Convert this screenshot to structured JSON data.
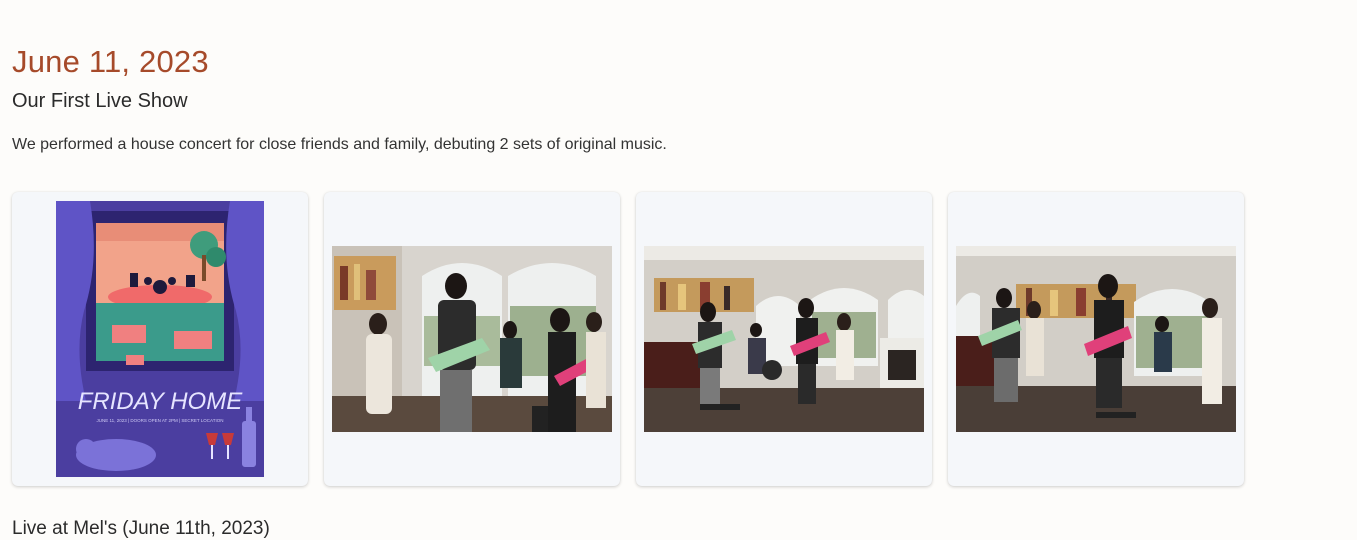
{
  "event": {
    "date": "June 11, 2023",
    "title": "Our First Live Show",
    "description": "We performed a house concert for close friends and family, debuting 2 sets of original music."
  },
  "gallery": {
    "poster": {
      "headline": "FRIDAY HOME",
      "fineprint": "JUNE 11, 2023 | DOORS OPEN AT 2PM | SECRET LOCATION"
    },
    "photo_count": 3
  },
  "next_section": {
    "heading": "Live at Mel's (June 11th, 2023)"
  },
  "colors": {
    "date_accent": "#a64a2a",
    "poster_bg": "#4b3ea0",
    "poster_curtain": "#5f54c6",
    "card_bg": "#f5f7fa"
  }
}
